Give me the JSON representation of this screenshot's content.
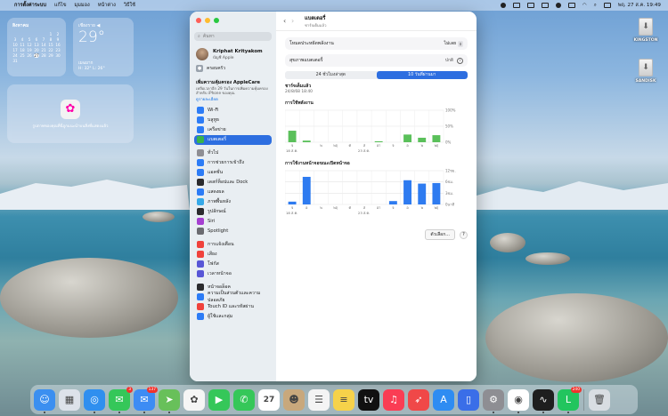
{
  "menubar": {
    "app_name": "การตั้งค่าระบบ",
    "items": [
      "แก้ไข",
      "มุมมอง",
      "หน้าต่าง",
      "วิธีใช้"
    ],
    "clock": "พฤ. 27 ส.ค. 19:49"
  },
  "calendar_widget": {
    "month": "สิงหาคม",
    "days": [
      "1",
      "2",
      "3",
      "4",
      "5",
      "6",
      "7",
      "8",
      "9",
      "10",
      "11",
      "12",
      "13",
      "14",
      "15",
      "16",
      "17",
      "18",
      "19",
      "20",
      "21",
      "22",
      "23",
      "24",
      "25",
      "26",
      "27",
      "28",
      "29",
      "30",
      "31"
    ],
    "today": "27"
  },
  "weather_widget": {
    "city": "เชียงราย ◀",
    "temp": "29°",
    "condition": "เมฆมาก",
    "high_low": "H: 32° L: 26°"
  },
  "photos_widget": {
    "text": "รูปภาพของคุณที่นี่ถูกแนะนำบนสิ่งที่แสดงแล้ว"
  },
  "drives": [
    {
      "label": "KINGSTON"
    },
    {
      "label": "SANDISK"
    }
  ],
  "window": {
    "search_placeholder": "ค้นหา",
    "profile_name": "Kriphat Krityakom",
    "profile_sub": "บัญชี Apple",
    "family_label": "ครอบครัว",
    "applecare": {
      "title": "เพิ่มความคุ้มครอง AppleCare",
      "desc": "เหลือเวลาอีก 29 วันในการเพิ่มความคุ้มครองสำหรับ iPhone ของคุณ",
      "link": "ดูรายละเอียด"
    },
    "sidebar_groups": [
      [
        {
          "label": "Wi-Fi",
          "color": "#2d7cf6",
          "icon": "wifi-icon"
        },
        {
          "label": "บลูทูธ",
          "color": "#2d7cf6",
          "icon": "bluetooth-icon"
        },
        {
          "label": "เครือข่าย",
          "color": "#2d7cf6",
          "icon": "network-icon"
        },
        {
          "label": "แบตเตอรี่",
          "color": "#38b44a",
          "icon": "battery-icon",
          "active": true
        }
      ],
      [
        {
          "label": "ทั่วไป",
          "color": "#8e8e93",
          "icon": "gear-icon"
        },
        {
          "label": "การช่วยการเข้าถึง",
          "color": "#2d7cf6",
          "icon": "accessibility-icon"
        },
        {
          "label": "แอคชั่น",
          "color": "#2d7cf6",
          "icon": "action-icon"
        },
        {
          "label": "เดสก์ท็อปและ Dock",
          "color": "#2b2b2e",
          "icon": "dock-icon"
        },
        {
          "label": "แสดงผล",
          "color": "#2d7cf6",
          "icon": "display-icon"
        },
        {
          "label": "ภาพพื้นหลัง",
          "color": "#36a9e8",
          "icon": "wallpaper-icon"
        },
        {
          "label": "รูปลักษณ์",
          "color": "#2b2b2e",
          "icon": "appearance-icon"
        },
        {
          "label": "Siri",
          "color": "#a63fd1",
          "icon": "siri-icon"
        },
        {
          "label": "Spotlight",
          "color": "#6b6b70",
          "icon": "spotlight-icon"
        }
      ],
      [
        {
          "label": "การแจ้งเตือน",
          "color": "#f0423c",
          "icon": "notifications-icon"
        },
        {
          "label": "เสียง",
          "color": "#f0423c",
          "icon": "sound-icon"
        },
        {
          "label": "โฟกัส",
          "color": "#5856d6",
          "icon": "focus-icon"
        },
        {
          "label": "เวลาหน้าจอ",
          "color": "#5856d6",
          "icon": "screen-time-icon"
        }
      ],
      [
        {
          "label": "หน้าจอล็อค",
          "color": "#2b2b2e",
          "icon": "lock-screen-icon"
        },
        {
          "label": "ความเป็นส่วนตัวและความปลอดภัย",
          "color": "#2d7cf6",
          "icon": "privacy-icon"
        },
        {
          "label": "Touch ID และรหัสผ่าน",
          "color": "#f0423c",
          "icon": "touchid-icon"
        },
        {
          "label": "ผู้ใช้และกลุ่ม",
          "color": "#2d7cf6",
          "icon": "users-icon"
        }
      ]
    ],
    "toolbar": {
      "title": "แบตเตอรี่",
      "subtitle": "ชาร์จเต็มแล้ว"
    },
    "low_power": {
      "label": "โหมดประหยัดพลังงาน",
      "value": "ไม่เลย"
    },
    "health": {
      "label": "สุขภาพแบตเตอรี่",
      "value": "ปกติ"
    },
    "tabs": [
      {
        "label": "24 ชั่วโมงล่าสุด",
        "active": false
      },
      {
        "label": "10 วันที่ผ่านมา",
        "active": true
      }
    ],
    "charge": {
      "label": "ชาร์จเต็มแล้ว",
      "time": "24/8/68 18:40"
    },
    "options_label": "ตัวเลือก...",
    "help_label": "?"
  },
  "chart_data": [
    {
      "type": "bar",
      "title": "การใช้พลังงาน",
      "categories": [
        "จ",
        "อ",
        "พ",
        "พฤ",
        "ศ",
        "ส",
        "อา",
        "จ",
        "อ",
        "พ",
        "พฤ"
      ],
      "x_tick_labels": [
        "จ",
        "",
        "พ",
        "พฤ",
        "ศ",
        "ส",
        "อา",
        "จ",
        "อ",
        "พ",
        "พฤ"
      ],
      "date_labels": [
        "18 ส.ค.",
        "23 ส.ค."
      ],
      "values": [
        36,
        5,
        0,
        0,
        0,
        0,
        3,
        0,
        24,
        14,
        22
      ],
      "ylim": [
        0,
        100
      ],
      "y_ticks": [
        "100%",
        "50%",
        "0%"
      ],
      "color": "#5ac05a"
    },
    {
      "type": "bar",
      "title": "การใช้งานหน้าจอขณะเปิดหน้าจอ",
      "categories": [
        "จ",
        "อ",
        "พ",
        "พฤ",
        "ศ",
        "ส",
        "อา",
        "จ",
        "อ",
        "พ",
        "พฤ"
      ],
      "x_tick_labels": [
        "จ",
        "อ",
        "พ",
        "พฤ",
        "ศ",
        "ส",
        "อา",
        "จ",
        "อ",
        "พ",
        "พฤ"
      ],
      "date_labels": [
        "18 ส.ค.",
        "23 ส.ค."
      ],
      "values": [
        1.0,
        9.8,
        0,
        0,
        0,
        0,
        0,
        1.2,
        8.6,
        7.4,
        7.6
      ],
      "ylim": [
        0,
        12
      ],
      "y_ticks": [
        "12ชม.",
        "6ชม.",
        "3ชม.",
        "0นาที"
      ],
      "color": "#2e7bf0"
    }
  ],
  "dock": [
    {
      "name": "Finder",
      "icon": "finder-icon",
      "color": "#3b8ff0",
      "glyph": "☺",
      "running": true
    },
    {
      "name": "Launchpad",
      "icon": "launchpad-icon",
      "color": "#dde2ea",
      "glyph": "▦"
    },
    {
      "name": "Safari",
      "icon": "safari-icon",
      "color": "#2f8fef",
      "glyph": "◎",
      "running": true
    },
    {
      "name": "Messages",
      "icon": "messages-icon",
      "color": "#35c759",
      "glyph": "✉",
      "badge": "3",
      "running": true
    },
    {
      "name": "Mail",
      "icon": "mail-icon",
      "color": "#3d8cf4",
      "glyph": "✉",
      "badge": "137",
      "running": true
    },
    {
      "name": "Maps",
      "icon": "maps-icon",
      "color": "#68c05a",
      "glyph": "➤",
      "running": true
    },
    {
      "name": "Photos",
      "icon": "photos-icon",
      "color": "#f5f5f5",
      "glyph": "✿"
    },
    {
      "name": "FaceTime",
      "icon": "facetime-icon",
      "color": "#35c759",
      "glyph": "▶"
    },
    {
      "name": "Phone",
      "icon": "phone-icon",
      "color": "#35c759",
      "glyph": "✆"
    },
    {
      "name": "Calendar",
      "icon": "calendar-icon",
      "color": "#ffffff",
      "glyph": "27"
    },
    {
      "name": "Contacts",
      "icon": "contacts-icon",
      "color": "#c8a87c",
      "glyph": "☻"
    },
    {
      "name": "Reminders",
      "icon": "reminders-icon",
      "color": "#f4f4f4",
      "glyph": "☰"
    },
    {
      "name": "Notes",
      "icon": "notes-icon",
      "color": "#f6d24a",
      "glyph": "≡"
    },
    {
      "name": "Apple TV",
      "icon": "tv-icon",
      "color": "#111111",
      "glyph": "tv"
    },
    {
      "name": "Music",
      "icon": "music-icon",
      "color": "#fa3d54",
      "glyph": "♫"
    },
    {
      "name": "Rocket",
      "icon": "rocket-icon",
      "color": "#f04848",
      "glyph": "➶"
    },
    {
      "name": "App Store",
      "icon": "appstore-icon",
      "color": "#2e8cf2",
      "glyph": "A"
    },
    {
      "name": "iPhone Mirroring",
      "icon": "iphone-mirroring-icon",
      "color": "#3a6ee8",
      "glyph": "▯"
    },
    {
      "name": "System Settings",
      "icon": "settings-icon",
      "color": "#8e8e93",
      "glyph": "⚙",
      "running": true
    },
    {
      "name": "Chrome",
      "icon": "chrome-icon",
      "color": "#ffffff",
      "glyph": "◉",
      "running": true
    },
    {
      "name": "Activity Monitor",
      "icon": "activity-monitor-icon",
      "color": "#1e1e1e",
      "glyph": "∿",
      "running": true
    },
    {
      "name": "LINE",
      "icon": "line-icon",
      "color": "#22c55e",
      "glyph": "L",
      "badge": "240",
      "running": true
    },
    {
      "name": "Trash",
      "icon": "trash-icon",
      "color": "#d9dde2",
      "glyph": "🗑"
    }
  ]
}
